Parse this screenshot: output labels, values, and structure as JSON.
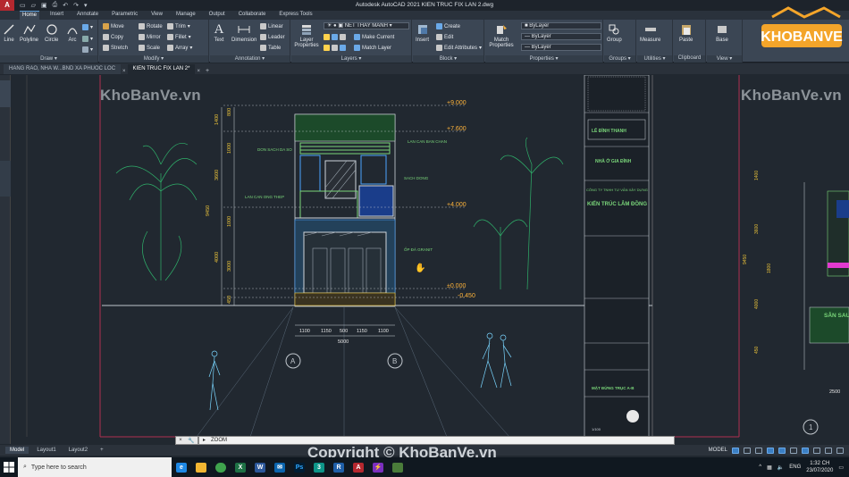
{
  "app": {
    "logo_letter": "A",
    "title": "Autodesk AutoCAD 2021   KIEN TRUC FIX LAN 2.dwg"
  },
  "ribbon_tabs": [
    "Home",
    "Insert",
    "Annotate",
    "Parametric",
    "View",
    "Manage",
    "Output",
    "Collaborate",
    "Express Tools"
  ],
  "ribbon": {
    "draw": {
      "title": "Draw",
      "line": "Line",
      "polyline": "Polyline",
      "circle": "Circle",
      "arc": "Arc"
    },
    "modify": {
      "title": "Modify",
      "move": "Move",
      "rotate": "Rotate",
      "trim": "Trim",
      "copy": "Copy",
      "mirror": "Mirror",
      "fillet": "Fillet",
      "stretch": "Stretch",
      "scale": "Scale",
      "array": "Array"
    },
    "annotation": {
      "title": "Annotation",
      "text": "Text",
      "dimension": "Dimension",
      "linear": "Linear",
      "leader": "Leader",
      "table": "Table"
    },
    "layers": {
      "title": "Layers",
      "layer_properties": "Layer Properties",
      "current_layer": "NET THAY MANH",
      "make_current": "Make Current",
      "match_layer": "Match Layer"
    },
    "block": {
      "title": "Block",
      "insert": "Insert",
      "create": "Create",
      "edit": "Edit",
      "edit_attributes": "Edit Attributes"
    },
    "properties": {
      "title": "Properties",
      "match_properties": "Match Properties",
      "color": "ByLayer",
      "linetype": "ByLayer",
      "lineweight": "ByLayer"
    },
    "groups": {
      "title": "Groups",
      "group": "Group"
    },
    "utilities": {
      "title": "Utilities",
      "measure": "Measure"
    },
    "clipboard": {
      "title": "Clipboard",
      "paste": "Paste"
    },
    "view": {
      "title": "View",
      "base": "Base"
    }
  },
  "doc_tabs": [
    "HANG RAO, NHA W...BND XA PHUOC LOC",
    "KIEN TRUC FIX LAN 2*"
  ],
  "drawing": {
    "watermark": "KhoBanVe.vn",
    "levels": [
      "+9.000",
      "+7.600",
      "+4.000",
      "±0.000",
      "-0.450"
    ],
    "notes": [
      "LAN CAN BAN CHAN",
      "DON SACH DA SO",
      "LAN CAN ONG THEP",
      "SACH DONG",
      "ỐP ĐÁ GRANIT"
    ],
    "bottom_dims": [
      "1100",
      "1150",
      "500",
      "1150",
      "1100"
    ],
    "total_width": "5000",
    "grid_axes": [
      "A",
      "B"
    ],
    "left_dims": [
      "800",
      "1400",
      "1000",
      "3600",
      "9450",
      "1000",
      "4000",
      "3000",
      "450",
      "800"
    ],
    "title_block": {
      "company": "CÔNG TY TNHH TƯ VẤN XÂY DỰNG",
      "firm_name": "KIẾN TRÚC LÂM ĐỒNG",
      "sheet_title": "MẶT ĐỨNG TRỤC A-B",
      "owner": "LÊ ĐÌNH THANH",
      "location": "NHÀ Ở GIA ĐÌNH",
      "scale": "1/100"
    },
    "right_view": {
      "label": "SÂN SAU",
      "dim": "2500",
      "axis": "1",
      "level_dims": [
        "1400",
        "3600",
        "9450",
        "1800",
        "4000",
        "450"
      ]
    }
  },
  "command": {
    "text": "ZOOM"
  },
  "layout_tabs": [
    "Model",
    "Layout1",
    "Layout2",
    "+"
  ],
  "status": {
    "model": "MODEL"
  },
  "taskbar": {
    "search_placeholder": "Type here to search",
    "lang": "ENG",
    "time": "1:32 CH",
    "date": "23/07/2020"
  },
  "overlay": {
    "copyright": "Copyright © KhoBanVe.vn",
    "badge": "KHOBANVE"
  },
  "colors": {
    "accent": "#5b9bd5",
    "autocad_red": "#b5282f",
    "layer_green": "#7ad67a"
  }
}
